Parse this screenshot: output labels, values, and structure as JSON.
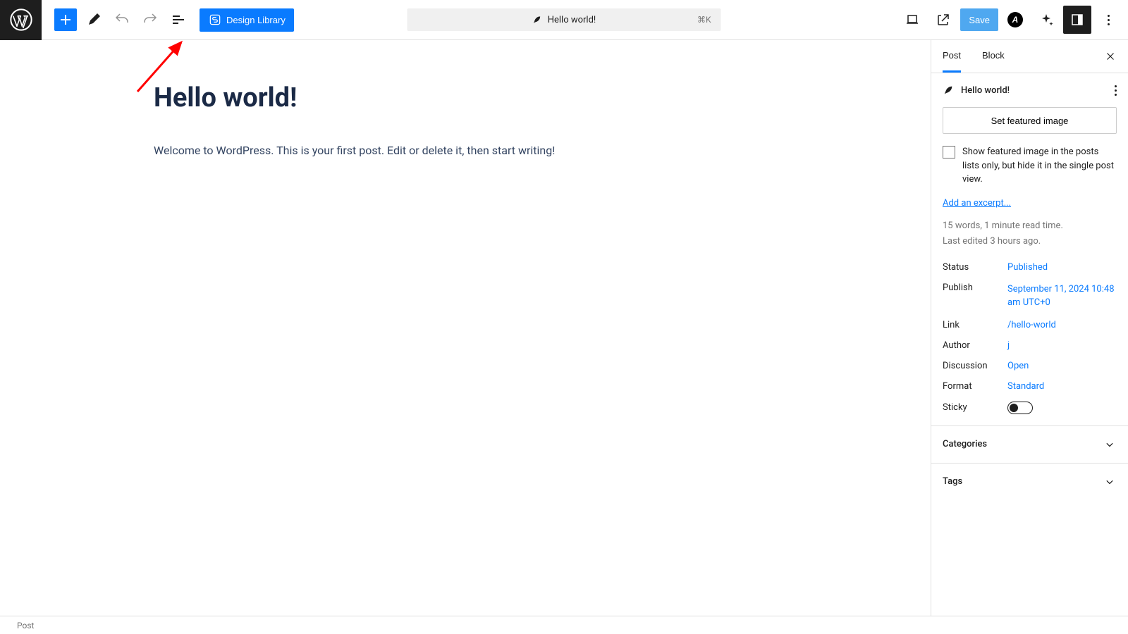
{
  "toolbar": {
    "design_library": "Design Library",
    "doc_title": "Hello world!",
    "shortcut": "⌘K",
    "save": "Save"
  },
  "editor": {
    "title": "Hello world!",
    "body": "Welcome to WordPress. This is your first post. Edit or delete it, then start writing!"
  },
  "sidebar": {
    "tabs": {
      "post": "Post",
      "block": "Block"
    },
    "title": "Hello world!",
    "featured_button": "Set featured image",
    "featured_checkbox": "Show featured image in the posts lists only, but hide it in the single post view.",
    "excerpt_link": "Add an excerpt...",
    "stats_line1": "15 words, 1 minute read time.",
    "stats_line2": "Last edited 3 hours ago.",
    "kv": {
      "status_label": "Status",
      "status_value": "Published",
      "publish_label": "Publish",
      "publish_value": "September 11, 2024 10:48 am UTC+0",
      "link_label": "Link",
      "link_value": "/hello-world",
      "author_label": "Author",
      "author_value": "j",
      "discussion_label": "Discussion",
      "discussion_value": "Open",
      "format_label": "Format",
      "format_value": "Standard",
      "sticky_label": "Sticky"
    },
    "panels": {
      "categories": "Categories",
      "tags": "Tags"
    }
  },
  "footer": {
    "breadcrumb": "Post"
  }
}
